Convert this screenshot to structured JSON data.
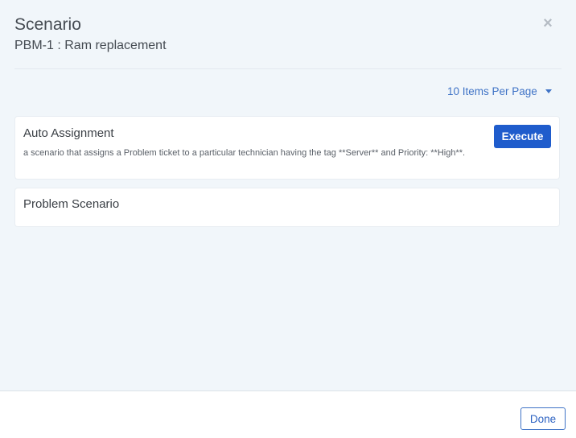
{
  "modal": {
    "title": "Scenario",
    "subtitle": "PBM-1 : Ram replacement",
    "close_icon": "×"
  },
  "pager": {
    "label": "10 Items Per Page"
  },
  "scenarios": [
    {
      "title": "Auto Assignment",
      "description": "a scenario that assigns a Problem ticket to a particular technician having the tag **Server** and Priority: **High**.",
      "action_label": "Execute"
    },
    {
      "title": "Problem Scenario"
    }
  ],
  "footer": {
    "done_label": "Done"
  },
  "colors": {
    "accent": "#1f5ccc",
    "link": "#3f73c6",
    "background": "#f1f6fa"
  }
}
